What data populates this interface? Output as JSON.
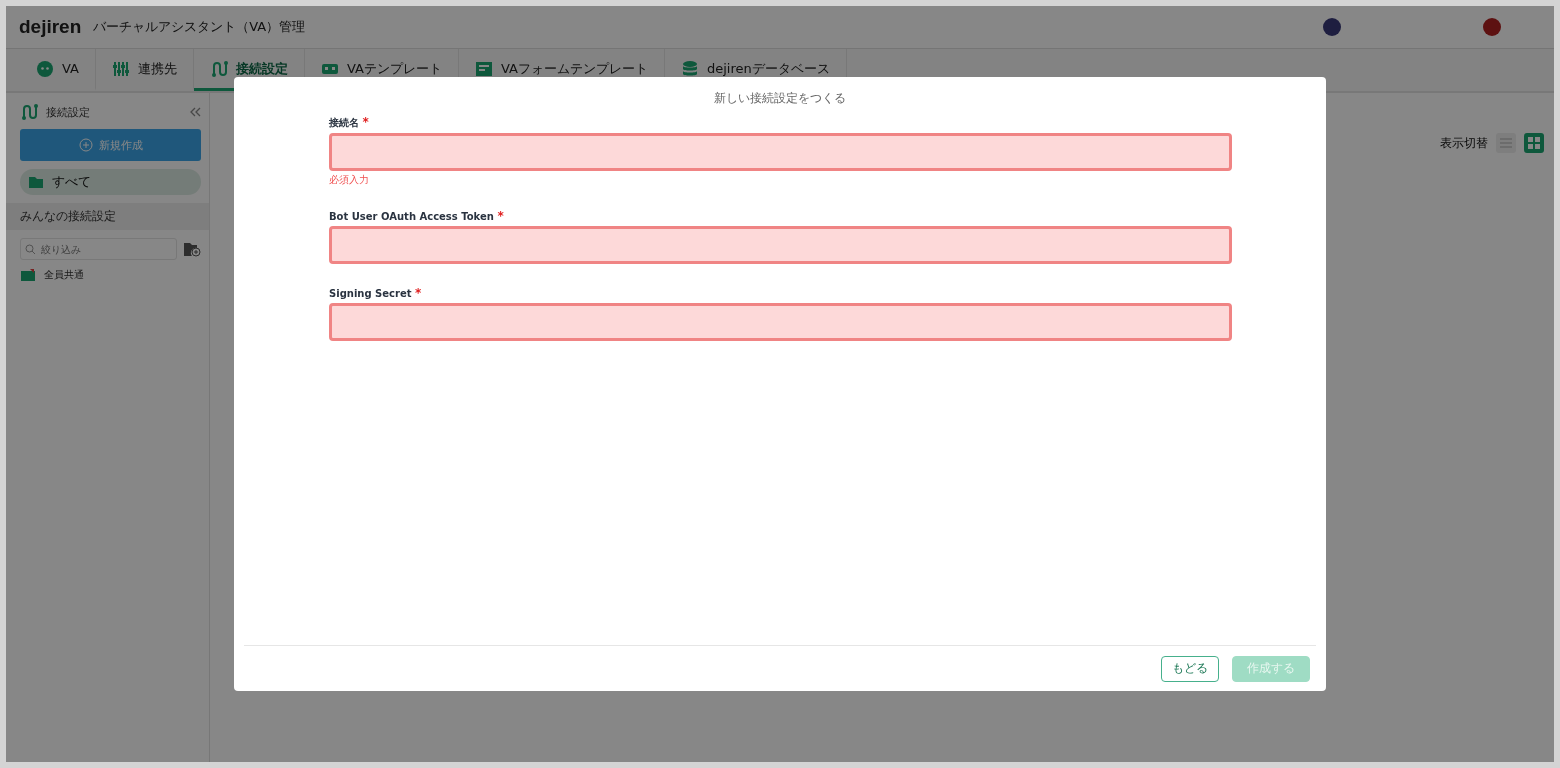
{
  "header": {
    "logo": "dejiren",
    "title": "バーチャルアシスタント（VA）管理"
  },
  "tabs": [
    {
      "label": "VA",
      "selected": false
    },
    {
      "label": "連携先",
      "selected": false
    },
    {
      "label": "接続設定",
      "selected": true
    },
    {
      "label": "VAテンプレート",
      "selected": false
    },
    {
      "label": "VAフォームテンプレート",
      "selected": false
    },
    {
      "label": "dejirenデータベース",
      "selected": false
    }
  ],
  "sidebar": {
    "title": "接続設定",
    "new_button": "新規作成",
    "items": [
      {
        "label": "すべて",
        "selected": true
      }
    ],
    "section": "みんなの接続設定",
    "filter": {
      "placeholder": "絞り込み"
    },
    "folders": [
      {
        "label": "全員共通"
      }
    ]
  },
  "content": {
    "view_toggle_label": "表示切替",
    "views": [
      {
        "kind": "list",
        "selected": false
      },
      {
        "kind": "grid",
        "selected": true
      }
    ]
  },
  "dialog": {
    "title": "新しい接続設定をつくる",
    "fields": [
      {
        "label": "接続名",
        "required_mark": "*",
        "error": true,
        "error_message": "必須入力"
      },
      {
        "label": "Bot User OAuth Access Token",
        "required_mark": "*",
        "error": true
      },
      {
        "label": "Signing Secret",
        "required_mark": "*",
        "error": true
      }
    ],
    "buttons": [
      {
        "label": "もどる",
        "kind": "secondary",
        "disabled": false
      },
      {
        "label": "作成する",
        "kind": "primary",
        "disabled": true
      }
    ]
  }
}
